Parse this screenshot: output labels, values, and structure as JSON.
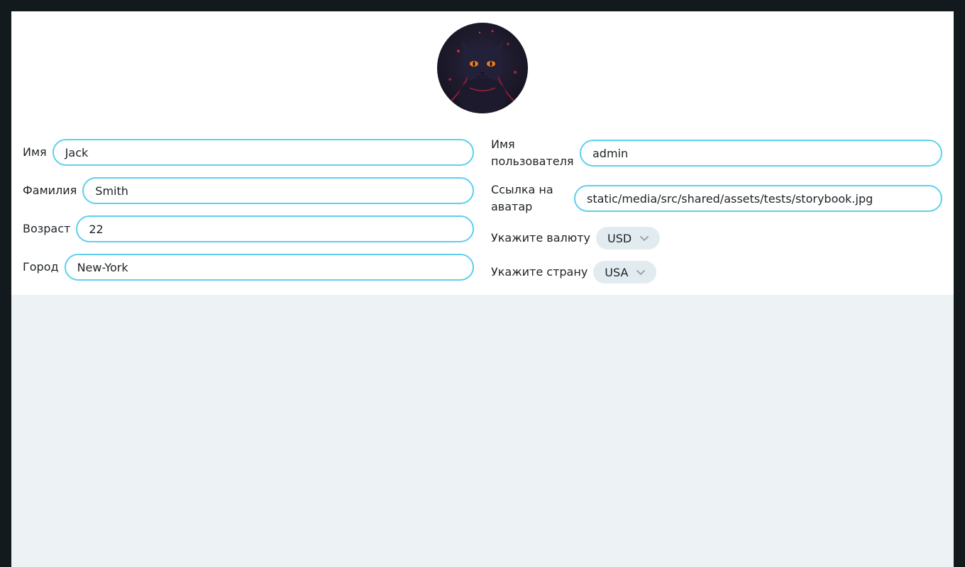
{
  "profile": {
    "avatar_alt": "avatar",
    "first_name": {
      "label": "Имя",
      "value": "Jack"
    },
    "last_name": {
      "label": "Фамилия",
      "value": "Smith"
    },
    "age": {
      "label": "Возраст",
      "value": "22"
    },
    "city": {
      "label": "Город",
      "value": "New-York"
    },
    "username": {
      "label": "Имя пользователя",
      "value": "admin"
    },
    "avatar_link": {
      "label": "Ссылка на аватар",
      "value": "static/media/src/shared/assets/tests/storybook.jpg"
    },
    "currency": {
      "label": "Укажите валюту",
      "value": "USD"
    },
    "country": {
      "label": "Укажите страну",
      "value": "USA"
    }
  },
  "colors": {
    "background": "#131a1d",
    "page": "#edf2f5",
    "card": "#ffffff",
    "accent": "#5cd0ee",
    "select_bg": "#e2ecf0"
  }
}
